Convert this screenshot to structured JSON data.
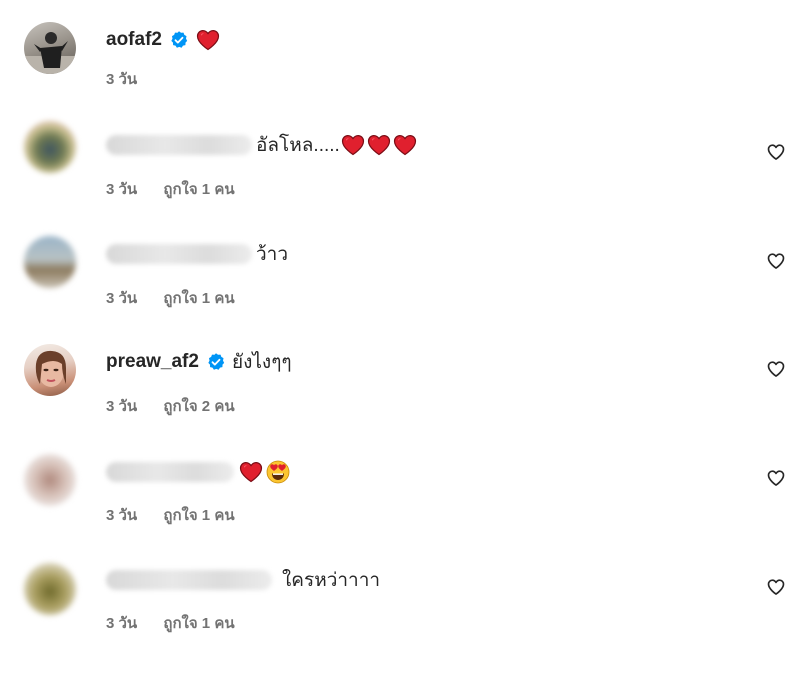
{
  "comments": [
    {
      "username": "aofaf2",
      "verified": true,
      "text": "",
      "time": "3 วัน",
      "likes": "",
      "show_like_button": false
    },
    {
      "username": "",
      "verified": false,
      "text": "อัลโหล.....",
      "time": "3 วัน",
      "likes": "ถูกใจ 1 คน",
      "show_like_button": true
    },
    {
      "username": "",
      "verified": false,
      "text": "ว้าว",
      "time": "3 วัน",
      "likes": "ถูกใจ 1 คน",
      "show_like_button": true
    },
    {
      "username": "preaw_af2",
      "verified": true,
      "text": "ยังไงๆๆ",
      "time": "3 วัน",
      "likes": "ถูกใจ 2 คน",
      "show_like_button": true
    },
    {
      "username": "",
      "verified": false,
      "text": "",
      "time": "3 วัน",
      "likes": "ถูกใจ 1 คน",
      "show_like_button": true
    },
    {
      "username": "",
      "verified": false,
      "text": "ใครหว่าาาา",
      "time": "3 วัน",
      "likes": "ถูกใจ 1 คน",
      "show_like_button": true
    }
  ],
  "icons": {
    "verified_badge": "verified-badge-icon",
    "heart_emoji": "red-heart-emoji",
    "heart_eyes_emoji": "heart-eyes-emoji",
    "like_button": "heart-outline-icon"
  },
  "colors": {
    "verified_blue": "#0095f6",
    "heart_red": "#e0202e",
    "meta_gray": "#737373",
    "text": "#262626"
  }
}
